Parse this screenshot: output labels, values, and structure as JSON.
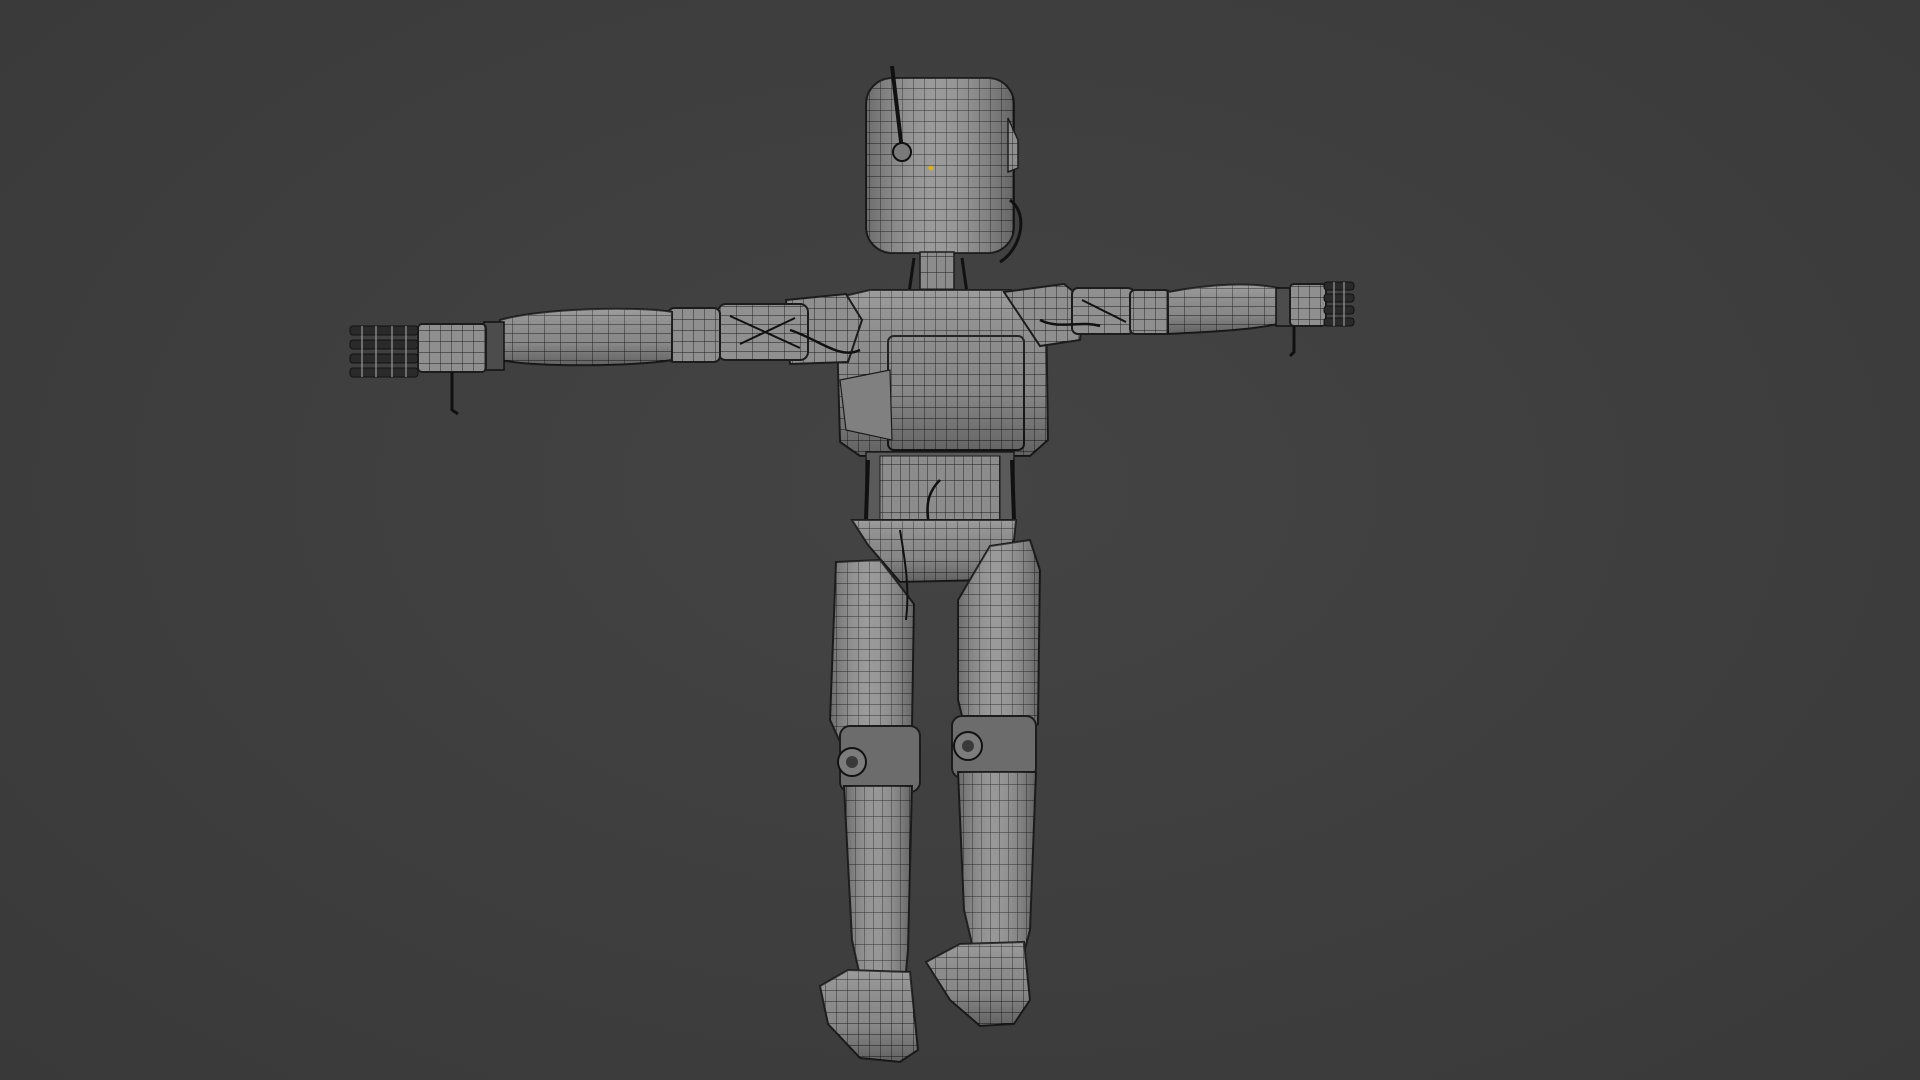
{
  "viewport": {
    "background_color": "#3d3d3d",
    "shading": "solid-wireframe"
  },
  "model": {
    "kind": "humanoid-robot",
    "pose": "t-pose",
    "surface_color": "#8f8f8f",
    "wire_color": "#1c1c1c",
    "highlight_color": "#b0b0b0",
    "shadow_color": "#6e6e6e",
    "accent_dot_color": "#d8b020"
  }
}
